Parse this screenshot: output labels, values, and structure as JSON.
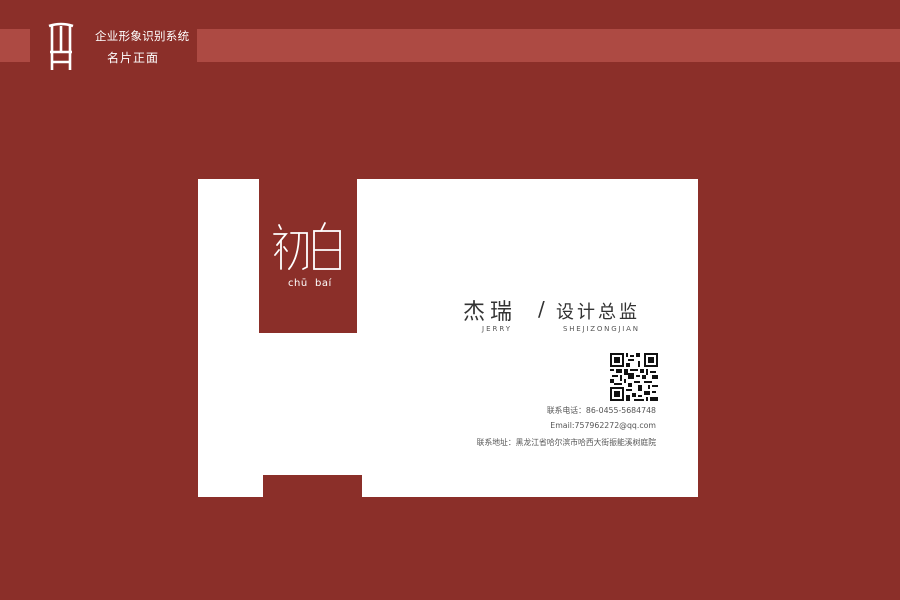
{
  "header": {
    "title": "企业形象识别系统",
    "subtitle": "名片正面",
    "logo_icon": "chair-icon"
  },
  "card": {
    "brand": {
      "name": "初白",
      "pinyin": [
        "chū",
        "baí"
      ]
    },
    "person": {
      "name": "杰瑞",
      "name_en": "JERRY",
      "separator": "/",
      "title": "设计总监",
      "title_en": "SHEJIZONGJIAN"
    },
    "qr_icon": "qr-code-icon",
    "contact": {
      "phone": "联系电话：86-0455-5684748",
      "email": "Email:757962272@qq.com",
      "address": "联系地址：黑龙江省哈尔滨市哈西大街振能溪树庭院"
    }
  },
  "colors": {
    "background": "#8b2f29",
    "band": "#ad4a43",
    "card": "#ffffff",
    "text": "#333333"
  }
}
